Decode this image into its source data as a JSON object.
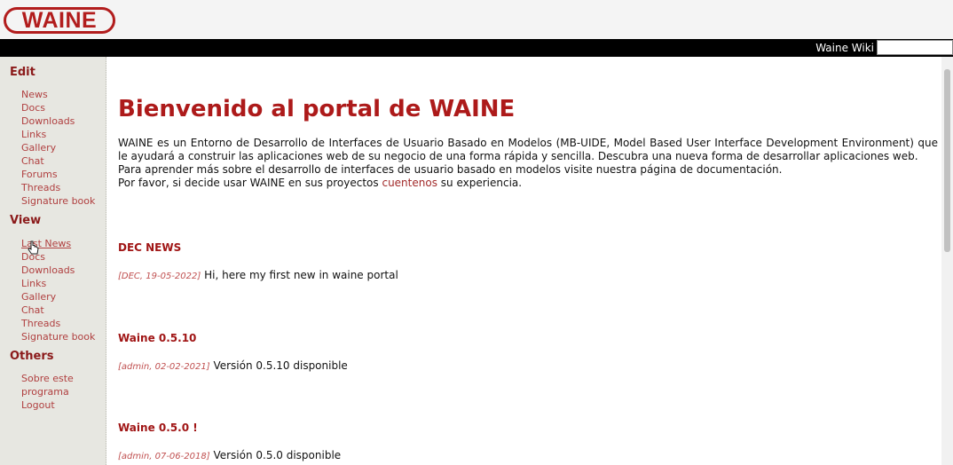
{
  "header": {
    "logo_text": "WAINE",
    "wiki_link": "Waine Wiki"
  },
  "sidebar": {
    "edit": {
      "title": "Edit",
      "items": [
        "News",
        "Docs",
        "Downloads",
        "Links",
        "Gallery",
        "Chat",
        "Forums",
        "Threads",
        "Signature book"
      ]
    },
    "view": {
      "title": "View",
      "items": [
        "Last News",
        "Docs",
        "Downloads",
        "Links",
        "Gallery",
        "Chat",
        "Threads",
        "Signature book"
      ]
    },
    "others": {
      "title": "Others",
      "items": [
        "Sobre este",
        "programa",
        "Logout"
      ]
    }
  },
  "main": {
    "title": "Bienvenido al portal de WAINE",
    "intro_p1": "WAINE es un Entorno de Desarrollo de Interfaces de Usuario Basado en Modelos (MB-UIDE, Model Based User Interface Development Environment) que le ayudará a construir las aplicaciones web de su negocio de una forma rápida y sencilla. Descubra una nueva forma de desarrollar aplicaciones web.",
    "intro_p2": "Para aprender más sobre el desarrollo de interfaces de usuario basado en modelos visite nuestra página de documentación.",
    "intro_p3_before": "Por favor, si decide usar WAINE en sus proyectos ",
    "intro_p3_link": "cuentenos",
    "intro_p3_after": " su experiencia.",
    "news": [
      {
        "title": "DEC NEWS",
        "meta": "[DEC, 19-05-2022]",
        "text": "Hi, here my first new in waine portal"
      },
      {
        "title": "Waine 0.5.10",
        "meta": "[admin, 02-02-2021]",
        "text": "Versión 0.5.10 disponible"
      },
      {
        "title": "Waine 0.5.0 !",
        "meta": "[admin, 07-06-2018]",
        "text": "Versión 0.5.0 disponible"
      }
    ]
  },
  "colors": {
    "brand": "#b21d1d",
    "sidebar_bg": "#e7e7e1",
    "link": "#b04040"
  },
  "cursor": {
    "icon": "hand-pointer-icon"
  }
}
